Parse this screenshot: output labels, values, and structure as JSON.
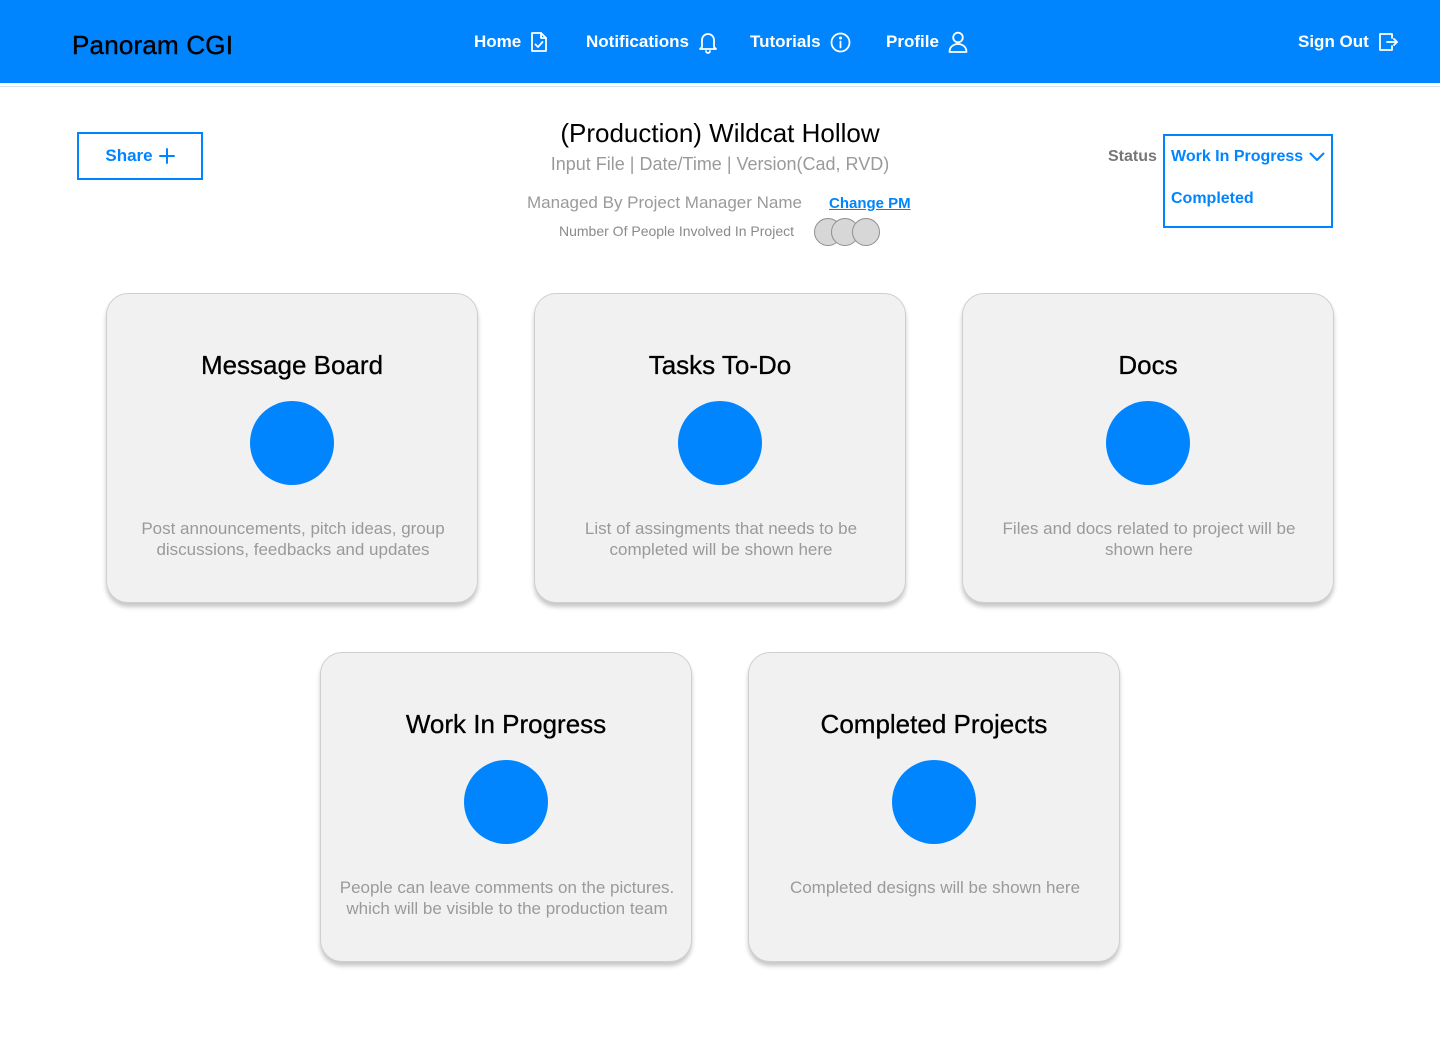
{
  "header": {
    "brand": "Panoram CGI",
    "nav": [
      {
        "label": "Home",
        "icon": "document-check-icon"
      },
      {
        "label": "Notifications",
        "icon": "bell-icon"
      },
      {
        "label": "Tutorials",
        "icon": "info-icon"
      },
      {
        "label": "Profile",
        "icon": "user-icon"
      }
    ],
    "sign_out": {
      "label": "Sign Out",
      "icon": "sign-out-icon"
    },
    "accent_color": "#0085FF"
  },
  "share": {
    "label": "Share",
    "icon": "plus-icon"
  },
  "project": {
    "title": "(Production) Wildcat Hollow",
    "meta": "Input File | Date/Time | Version(Cad, RVD)",
    "managed_by": "Managed By Project Manager Name",
    "change_pm": "Change PM",
    "people_label": "Number Of People Involved In Project"
  },
  "status": {
    "label": "Status",
    "selected": "Work In Progress",
    "options": [
      "Completed"
    ]
  },
  "cards": [
    {
      "title": "Message Board",
      "description": "Post announcements, pitch ideas, group discussions, feedbacks and updates"
    },
    {
      "title": "Tasks To-Do",
      "description": "List of assingments that needs to be completed will be shown here"
    },
    {
      "title": "Docs",
      "description": "Files and docs related to project will be shown here"
    },
    {
      "title": "Work In Progress",
      "description": "People can leave comments on the pictures. which will be visible to the production team"
    },
    {
      "title": "Completed Projects",
      "description": "Completed designs will be shown here"
    }
  ]
}
